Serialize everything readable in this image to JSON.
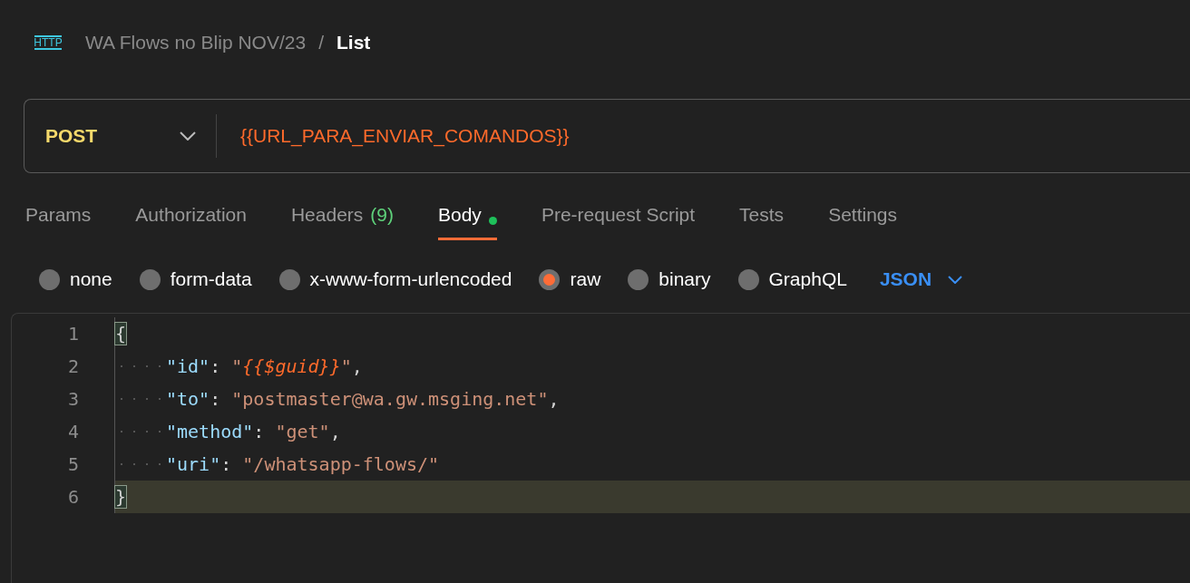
{
  "header": {
    "icon_text": "HTTP",
    "collection": "WA Flows no Blip NOV/23",
    "separator": "/",
    "request_name": "List"
  },
  "request": {
    "method": "POST",
    "url": "{{URL_PARA_ENVIAR_COMANDOS}}"
  },
  "tabs": [
    {
      "label": "Params",
      "selected": false
    },
    {
      "label": "Authorization",
      "selected": false
    },
    {
      "label": "Headers",
      "count": "(9)",
      "selected": false
    },
    {
      "label": "Body",
      "indicator": true,
      "selected": true
    },
    {
      "label": "Pre-request Script",
      "selected": false
    },
    {
      "label": "Tests",
      "selected": false
    },
    {
      "label": "Settings",
      "selected": false
    }
  ],
  "body_types": [
    {
      "label": "none",
      "selected": false
    },
    {
      "label": "form-data",
      "selected": false
    },
    {
      "label": "x-www-form-urlencoded",
      "selected": false
    },
    {
      "label": "raw",
      "selected": true
    },
    {
      "label": "binary",
      "selected": false
    },
    {
      "label": "GraphQL",
      "selected": false
    }
  ],
  "format": "JSON",
  "editor": {
    "lines": [
      {
        "number": "1",
        "indented": false,
        "current": false,
        "tokens": [
          {
            "kind": "brace",
            "text": "{",
            "matched": true
          }
        ]
      },
      {
        "number": "2",
        "indented": true,
        "current": false,
        "tokens": [
          {
            "kind": "key",
            "text": "\"id\""
          },
          {
            "kind": "punct",
            "text": ": "
          },
          {
            "kind": "string",
            "text": "\""
          },
          {
            "kind": "variable",
            "text": "{{$guid}}"
          },
          {
            "kind": "string",
            "text": "\""
          },
          {
            "kind": "punct",
            "text": ","
          }
        ]
      },
      {
        "number": "3",
        "indented": true,
        "current": false,
        "tokens": [
          {
            "kind": "key",
            "text": "\"to\""
          },
          {
            "kind": "punct",
            "text": ": "
          },
          {
            "kind": "string",
            "text": "\"postmaster@wa.gw.msging.net\""
          },
          {
            "kind": "punct",
            "text": ","
          }
        ]
      },
      {
        "number": "4",
        "indented": true,
        "current": false,
        "tokens": [
          {
            "kind": "key",
            "text": "\"method\""
          },
          {
            "kind": "punct",
            "text": ": "
          },
          {
            "kind": "string",
            "text": "\"get\""
          },
          {
            "kind": "punct",
            "text": ","
          }
        ]
      },
      {
        "number": "5",
        "indented": true,
        "current": false,
        "tokens": [
          {
            "kind": "key",
            "text": "\"uri\""
          },
          {
            "kind": "punct",
            "text": ": "
          },
          {
            "kind": "string",
            "text": "\"/whatsapp-flows/\""
          }
        ]
      },
      {
        "number": "6",
        "indented": false,
        "current": true,
        "tokens": [
          {
            "kind": "brace",
            "text": "}",
            "matched": true
          }
        ]
      }
    ]
  }
}
